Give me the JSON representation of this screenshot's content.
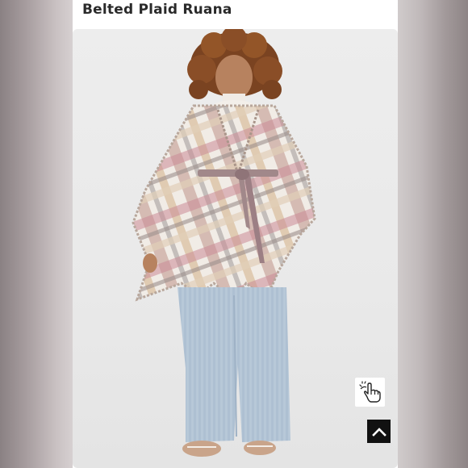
{
  "product": {
    "title": "Belted Plaid Ruana"
  },
  "photo": {
    "alt": "Model wearing a belted plaid ruana"
  },
  "icons": {
    "tap_hint": "hand-pointer-icon",
    "back_to_top": "chevron-up-icon"
  },
  "colors": {
    "page_background": "#ffffff",
    "title_text": "#2a2a2a",
    "back_to_top_bg": "#111111"
  }
}
